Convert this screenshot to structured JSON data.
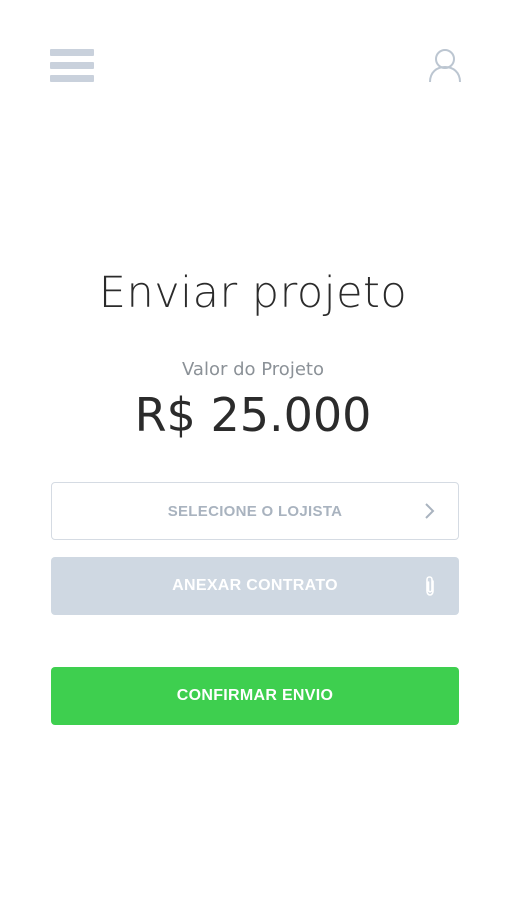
{
  "header": {
    "menu_icon": "hamburger-menu-icon",
    "profile_icon": "user-profile-icon"
  },
  "main": {
    "title": "Enviar projeto",
    "value_label": "Valor do Projeto",
    "value_amount": "R$ 25.000"
  },
  "actions": {
    "select_merchant_label": "SELECIONE O LOJISTA",
    "select_merchant_icon": "chevron-right-icon",
    "attach_contract_label": "ANEXAR CONTRATO",
    "attach_contract_icon": "paperclip-icon",
    "confirm_label": "CONFIRMAR ENVIO"
  },
  "colors": {
    "accent_green": "#3ecf4f",
    "disabled_gray": "#cfd8e2",
    "icon_gray": "#c9d1dc",
    "text_dark": "#2b2b2b",
    "text_muted": "#8b9197"
  }
}
